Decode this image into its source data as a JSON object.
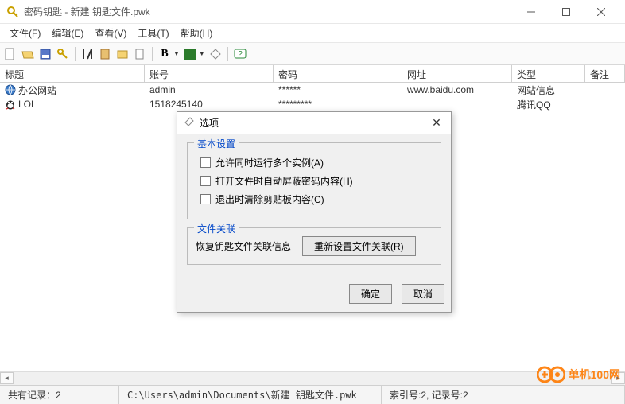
{
  "window": {
    "title": "密码钥匙 - 新建 钥匙文件.pwk"
  },
  "menu": {
    "items": [
      "文件(F)",
      "编辑(E)",
      "查看(V)",
      "工具(T)",
      "帮助(H)"
    ]
  },
  "columns": [
    "标题",
    "账号",
    "密码",
    "网址",
    "类型",
    "备注"
  ],
  "rows": [
    {
      "icon": "globe",
      "title": "办公网站",
      "account": "admin",
      "password": "******",
      "url": "www.baidu.com",
      "type": "网站信息",
      "note": ""
    },
    {
      "icon": "qq",
      "title": "LOL",
      "account": "1518245140",
      "password": "*********",
      "url": "",
      "type": "腾讯QQ",
      "note": ""
    }
  ],
  "dialog": {
    "title": "选项",
    "group1": {
      "label": "基本设置",
      "items": [
        "允许同时运行多个实例(A)",
        "打开文件时自动屏蔽密码内容(H)",
        "退出时清除剪贴板内容(C)"
      ]
    },
    "group2": {
      "label": "文件关联",
      "text": "恢复钥匙文件关联信息",
      "button": "重新设置文件关联(R)"
    },
    "ok": "确定",
    "cancel": "取消"
  },
  "status": {
    "left": "共有记录：2",
    "mid": "C:\\Users\\admin\\Documents\\新建 钥匙文件.pwk",
    "right": "索引号:2, 记录号:2"
  },
  "watermark": "单机100网"
}
